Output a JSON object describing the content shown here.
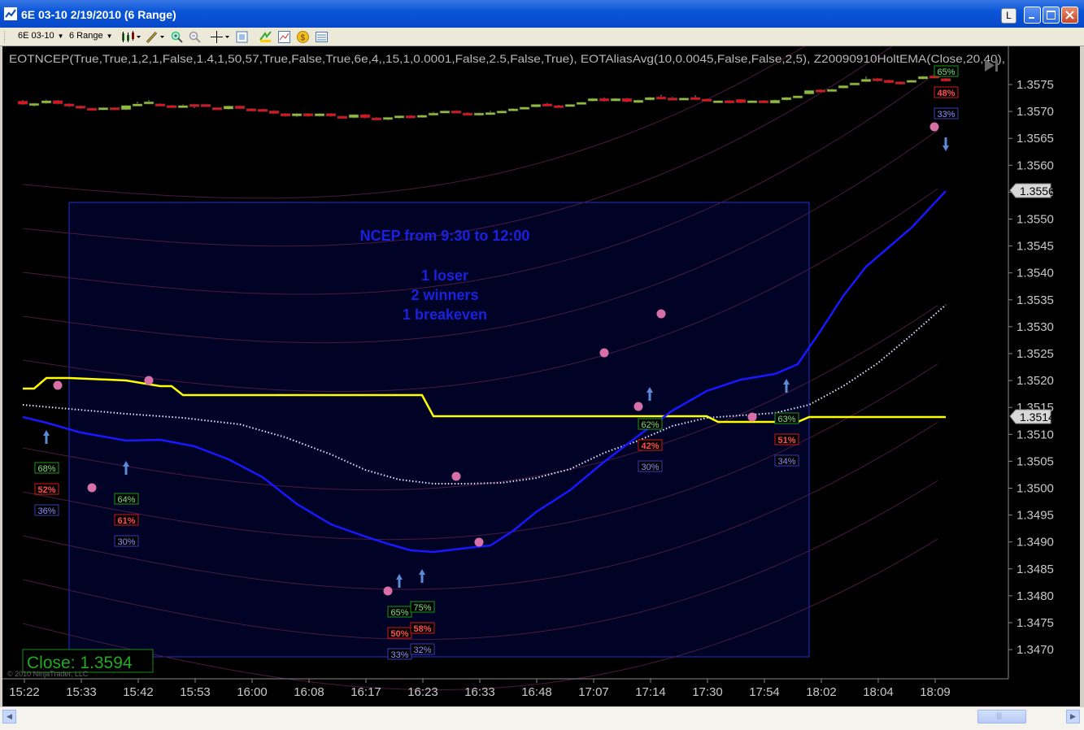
{
  "window": {
    "title": "6E 03-10   2/19/2010 (6 Range)",
    "buttons": {
      "l": "L",
      "min": "_",
      "max": "□",
      "close": "✕"
    }
  },
  "toolbar": {
    "instrument": "6E 03-10",
    "interval": "6 Range",
    "icons": [
      "bar-type-icon",
      "draw-pencil-icon",
      "zoom-in-icon",
      "zoom-out-icon",
      "crosshair-icon",
      "properties-icon",
      "strategies-icon",
      "indicators-icon",
      "market-analyzer-icon",
      "data-box-icon"
    ]
  },
  "chart": {
    "indicator_text": "EOTNCEP(True,True,1,2,1,False,1.4,1,50,57,True,False,True,6e,4,,15,1,0.0001,False,2.5,False,True),   EOTAliasAvg(10,0.0045,False,False,2,5),   Z20090910HoltEMA(Close,20,40),",
    "annotation": {
      "title": "NCEP from 9:30 to 12:00",
      "lines": [
        "1 loser",
        "2 winners",
        "1 breakeven"
      ]
    },
    "close_label": "Close: 1.3594",
    "copyright": "© 2010 NinjaTrader, LLC",
    "price_labels": [
      "1.3575",
      "1.3570",
      "1.3565",
      "1.3560",
      "1.3555",
      "1.3550",
      "1.3545",
      "1.3540",
      "1.3535",
      "1.3530",
      "1.3525",
      "1.3520",
      "1.3515",
      "1.3510",
      "1.3505",
      "1.3500",
      "1.3495",
      "1.3490",
      "1.3485",
      "1.3480",
      "1.3475",
      "1.3470"
    ],
    "time_labels": [
      "15:22",
      "15:33",
      "15:42",
      "15:53",
      "16:00",
      "16:08",
      "16:17",
      "16:23",
      "16:33",
      "16:48",
      "17:07",
      "17:14",
      "17:30",
      "17:54",
      "18:02",
      "18:04",
      "18:09"
    ],
    "current_price": "1.3556",
    "level_price": "1.3514",
    "colors": {
      "up": "#8fbc3a",
      "down": "#e8101c",
      "ema": "#1818ff",
      "dots": "#e8e8ff",
      "level": "#ffff00",
      "box": "#2030c0",
      "annotation": "#1a22e0"
    },
    "pct_boxes": [
      {
        "green": "68%",
        "red": "52%",
        "blue": "36%"
      },
      {
        "green": "64%",
        "red": "61%",
        "blue": "30%"
      },
      {
        "green": "65%",
        "red": "50%",
        "blue": "33%"
      },
      {
        "green": "75%",
        "red": "58%",
        "blue": "32%"
      },
      {
        "green": "62%",
        "red": "42%",
        "blue": "30%"
      },
      {
        "green": "63%",
        "red": "51%",
        "blue": "34%"
      },
      {
        "green": "65%",
        "red": "48%",
        "blue": "33%"
      }
    ]
  },
  "scrollbar": {
    "left": "◀",
    "right": "▶",
    "thumb_grip": "|||"
  }
}
